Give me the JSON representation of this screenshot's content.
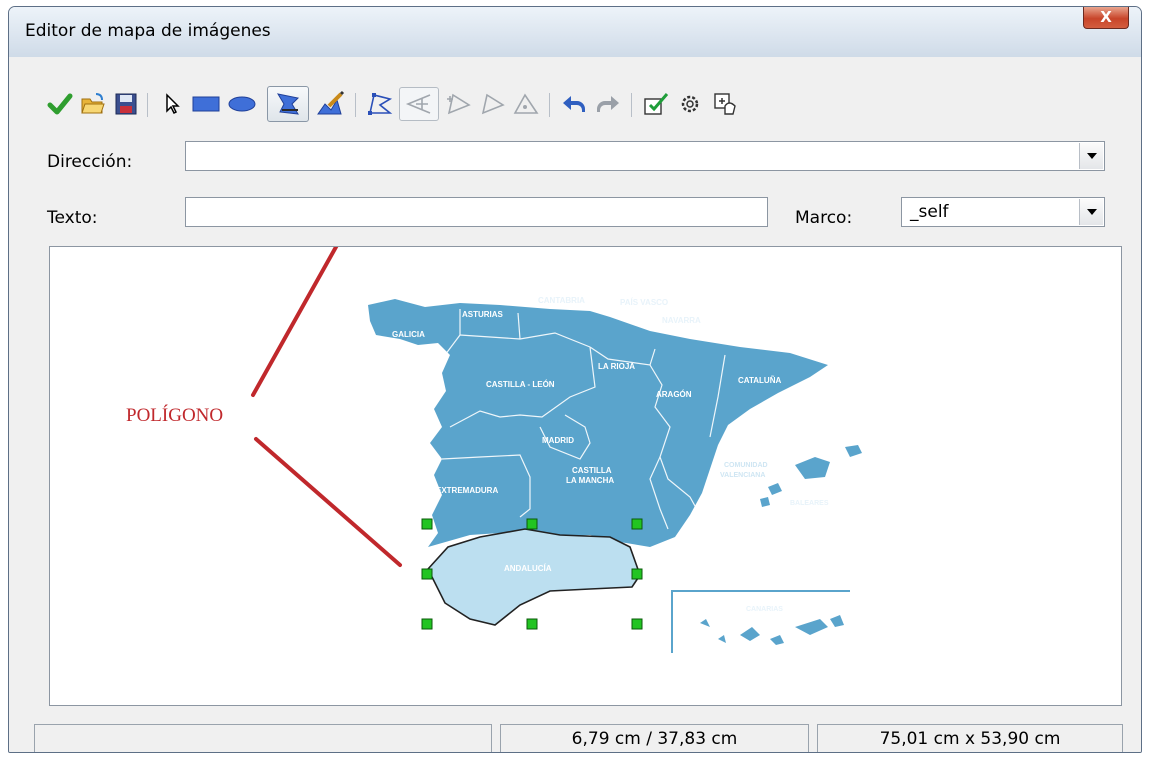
{
  "window": {
    "title": "Editor de mapa de imágenes",
    "close_symbol": "X"
  },
  "toolbar": {
    "buttons": [
      "apply-icon",
      "open-icon",
      "save-icon",
      "select-arrow-icon",
      "rectangle-icon",
      "ellipse-icon",
      "polygon-icon",
      "freeform-polygon-icon",
      "edit-points-icon",
      "move-points-icon",
      "insert-points-icon",
      "delete-points-icon",
      "undo-icon",
      "redo-icon",
      "active-icon",
      "macro-icon",
      "properties-icon"
    ],
    "pressed": [
      "polygon-icon",
      "move-points-icon"
    ]
  },
  "form": {
    "address_label": "Dirección:",
    "address_value": "",
    "text_label": "Texto:",
    "text_value": "",
    "frame_label": "Marco:",
    "frame_value": "_self"
  },
  "annotation": {
    "text": "POLÍGONO",
    "color": "#c0282c"
  },
  "map": {
    "regions": [
      "GALICIA",
      "ASTURIAS",
      "CANTABRIA",
      "PAÍS VASCO",
      "NAVARRA",
      "LA RIOJA",
      "CASTILLA - LEÓN",
      "ARAGÓN",
      "CATALUÑA",
      "MADRID",
      "CASTILLA",
      "LA MANCHA",
      "EXTREMADURA",
      "ANDALUCÍA",
      "MURCIA",
      "COMUNIDAD",
      "VALENCIANA",
      "BALEARES",
      "CANARIAS"
    ],
    "land_color": "#5aa4cc",
    "selected_color": "#bcdff0"
  },
  "status": {
    "left": "",
    "position": "6,79 cm / 37,83 cm",
    "size": "75,01 cm x 53,90 cm"
  }
}
